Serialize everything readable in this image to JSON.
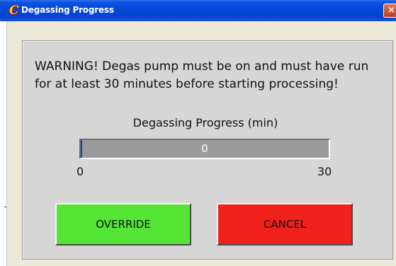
{
  "window": {
    "title": "Degassing Progress",
    "close_glyph": "×",
    "app_icon_glyph": "C",
    "titlebar_color": "#0448d8"
  },
  "message": {
    "warning": "WARNING! Degas pump must be on and must have run for at least 30 minutes before starting processing!"
  },
  "progress": {
    "label": "Degassing Progress (min)",
    "value_text": "0",
    "value": 0,
    "min_label": "0",
    "max_label": "30",
    "fill_color": "#1f3fb8"
  },
  "buttons": {
    "override_label": "OVERRIDE",
    "override_color": "#55e635",
    "cancel_label": "CANCEL",
    "cancel_color": "#f0201b"
  }
}
